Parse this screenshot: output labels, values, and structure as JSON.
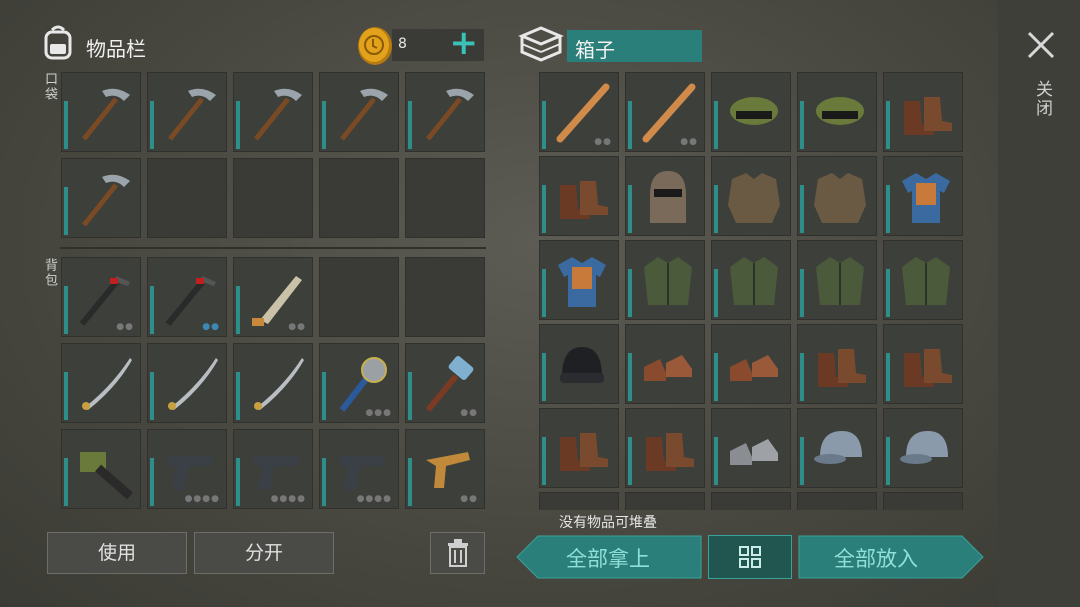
{
  "inventory": {
    "title": "物品栏",
    "coins": "8",
    "add_symbol": "+",
    "pocket_label": "口袋",
    "backpack_label": "背包",
    "pocket_slots": [
      {
        "icon": "pickaxe-icon",
        "dots": ""
      },
      {
        "icon": "pickaxe-icon",
        "dots": ""
      },
      {
        "icon": "pickaxe-icon",
        "dots": ""
      },
      {
        "icon": "pickaxe-icon",
        "dots": ""
      },
      {
        "icon": "pickaxe-icon",
        "dots": ""
      },
      {
        "icon": "pickaxe-icon",
        "dots": ""
      },
      {
        "icon": "",
        "dots": ""
      },
      {
        "icon": "",
        "dots": ""
      },
      {
        "icon": "",
        "dots": ""
      },
      {
        "icon": "",
        "dots": ""
      }
    ],
    "backpack_slots": [
      {
        "icon": "crowbar-icon",
        "dots": "●●"
      },
      {
        "icon": "crowbar-icon",
        "dots": "●●",
        "blue": true
      },
      {
        "icon": "machete-icon",
        "dots": "●●"
      },
      {
        "icon": "",
        "dots": ""
      },
      {
        "icon": "",
        "dots": ""
      },
      {
        "icon": "katana-icon",
        "dots": ""
      },
      {
        "icon": "katana-icon",
        "dots": ""
      },
      {
        "icon": "katana-icon",
        "dots": ""
      },
      {
        "icon": "saw-mace-icon",
        "dots": "●●●"
      },
      {
        "icon": "sledgehammer-icon",
        "dots": "●●"
      },
      {
        "icon": "chainsaw-icon",
        "dots": ""
      },
      {
        "icon": "pistol-icon",
        "dots": "●●●●"
      },
      {
        "icon": "pistol-icon",
        "dots": "●●●●"
      },
      {
        "icon": "pistol-icon",
        "dots": "●●●●"
      },
      {
        "icon": "flare-gun-icon",
        "dots": "●●"
      }
    ],
    "use_label": "使用",
    "split_label": "分开"
  },
  "box": {
    "title": "箱子",
    "status": "没有物品可堆叠",
    "take_all_label": "全部拿上",
    "put_all_label": "全部放入",
    "slots": [
      {
        "icon": "bat-icon",
        "dots": "●●"
      },
      {
        "icon": "bat-icon",
        "dots": "●●"
      },
      {
        "icon": "camo-cap-icon",
        "dots": ""
      },
      {
        "icon": "camo-cap-icon",
        "dots": ""
      },
      {
        "icon": "boots-icon",
        "dots": ""
      },
      {
        "icon": "boots-icon",
        "dots": ""
      },
      {
        "icon": "helmet-icon",
        "dots": ""
      },
      {
        "icon": "armor-vest-icon",
        "dots": ""
      },
      {
        "icon": "armor-vest-icon",
        "dots": ""
      },
      {
        "icon": "blue-shirt-icon",
        "dots": ""
      },
      {
        "icon": "blue-shirt-icon",
        "dots": ""
      },
      {
        "icon": "jacket-icon",
        "dots": ""
      },
      {
        "icon": "jacket-icon",
        "dots": ""
      },
      {
        "icon": "jacket-icon",
        "dots": ""
      },
      {
        "icon": "jacket-icon",
        "dots": ""
      },
      {
        "icon": "beanie-icon",
        "dots": ""
      },
      {
        "icon": "shoes-icon",
        "dots": ""
      },
      {
        "icon": "shoes-icon",
        "dots": ""
      },
      {
        "icon": "boots-icon",
        "dots": ""
      },
      {
        "icon": "boots-icon",
        "dots": ""
      },
      {
        "icon": "boots-icon",
        "dots": ""
      },
      {
        "icon": "boots-icon",
        "dots": ""
      },
      {
        "icon": "sneakers-icon",
        "dots": ""
      },
      {
        "icon": "baseball-cap-icon",
        "dots": ""
      },
      {
        "icon": "baseball-cap-icon",
        "dots": ""
      }
    ]
  },
  "close_label": "关闭",
  "colors": {
    "accent": "#2a7f7a",
    "bar": "#2e8f8a",
    "coin": "#e2a21b"
  }
}
